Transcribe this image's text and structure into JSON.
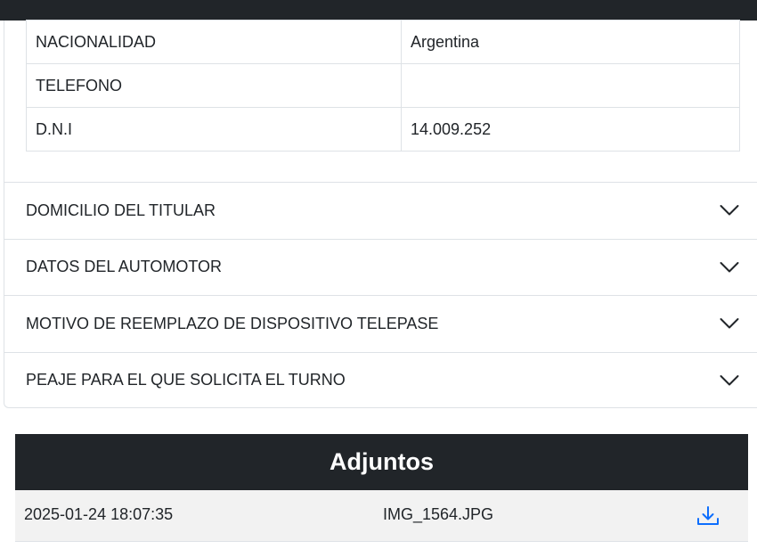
{
  "info_table": {
    "rows": [
      {
        "label": "NACIONALIDAD",
        "value": "Argentina"
      },
      {
        "label": "TELEFONO",
        "value": ""
      },
      {
        "label": "D.N.I",
        "value": "14.009.252"
      }
    ]
  },
  "accordion": {
    "items": [
      {
        "label": "DOMICILIO DEL TITULAR",
        "icon": "chevron-down-icon"
      },
      {
        "label": "DATOS DEL AUTOMOTOR",
        "icon": "chevron-down-icon"
      },
      {
        "label": "MOTIVO DE REEMPLAZO DE DISPOSITIVO TELEPASE",
        "icon": "chevron-down-icon"
      },
      {
        "label": "PEAJE PARA EL QUE SOLICITA EL TURNO",
        "icon": "chevron-down-icon"
      }
    ]
  },
  "adjuntos": {
    "title": "Adjuntos",
    "rows": [
      {
        "date": "2025-01-24 18:07:35",
        "filename": "IMG_1564.JPG",
        "icon": "download-icon"
      }
    ]
  },
  "colors": {
    "dark": "#212529",
    "border": "#dee2e6",
    "accent": "#0d6efd",
    "row_bg": "#f2f2f2"
  }
}
